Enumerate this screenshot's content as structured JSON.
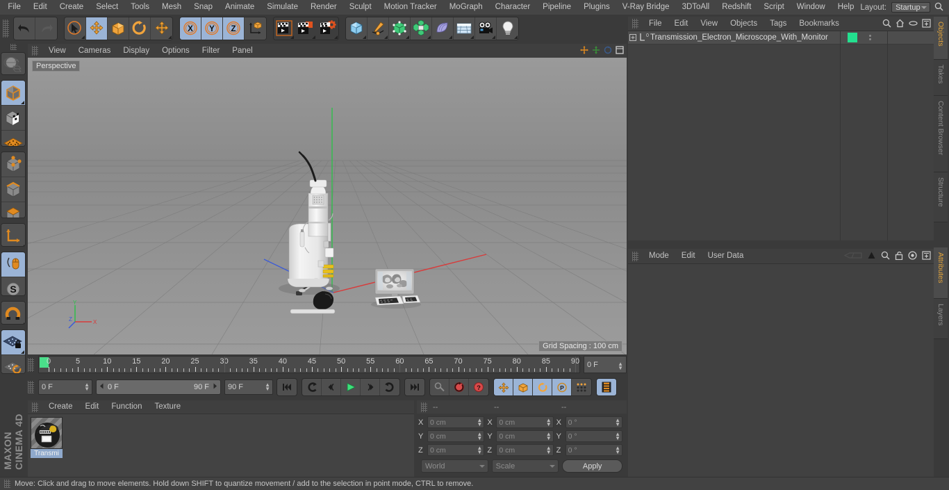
{
  "app": {
    "brand_bold": "MAXON",
    "brand_thin": "CINEMA 4D"
  },
  "menubar": {
    "items": [
      "File",
      "Edit",
      "Create",
      "Select",
      "Tools",
      "Mesh",
      "Snap",
      "Animate",
      "Simulate",
      "Render",
      "Sculpt",
      "Motion Tracker",
      "MoGraph",
      "Character",
      "Pipeline",
      "Plugins",
      "V-Ray Bridge",
      "3DToAll",
      "Redshift",
      "Script",
      "Window",
      "Help"
    ],
    "layout_label": "Layout:",
    "layout_value": "Startup",
    "search_icon": "search-icon"
  },
  "toolbar": {
    "groups": [
      {
        "name": "undo-redo",
        "buttons": [
          {
            "icon": "undo-icon",
            "label": "Undo",
            "selected": false
          },
          {
            "icon": "redo-icon",
            "label": "Redo",
            "selected": false
          }
        ]
      },
      {
        "name": "transform-tools",
        "buttons": [
          {
            "icon": "live-selection-icon",
            "label": "Live Selection",
            "selected": false
          },
          {
            "icon": "move-icon",
            "label": "Move",
            "selected": true
          },
          {
            "icon": "scale-icon",
            "label": "Scale",
            "selected": false
          },
          {
            "icon": "rotate-icon",
            "label": "Rotate",
            "selected": false
          },
          {
            "icon": "move-alt-icon",
            "label": "Move Alt",
            "selected": false
          }
        ]
      },
      {
        "name": "axis-locks",
        "buttons": [
          {
            "icon": "x-axis-icon",
            "label": "X",
            "selected": true
          },
          {
            "icon": "y-axis-icon",
            "label": "Y",
            "selected": true
          },
          {
            "icon": "z-axis-icon",
            "label": "Z",
            "selected": true
          },
          {
            "icon": "world-coordinates-icon",
            "label": "World / Object",
            "selected": false
          }
        ]
      },
      {
        "name": "render-tools",
        "buttons": [
          {
            "icon": "render-view-icon",
            "label": "Render View",
            "selected": false
          },
          {
            "icon": "render-region-icon",
            "label": "Render Region",
            "selected": false
          },
          {
            "icon": "render-settings-icon",
            "label": "Render Settings",
            "selected": false
          }
        ]
      },
      {
        "name": "create-objects",
        "buttons": [
          {
            "icon": "cube-primitive-icon",
            "label": "Add Cube Object",
            "selected": false
          },
          {
            "icon": "spline-pen-icon",
            "label": "Add Spline",
            "selected": false
          },
          {
            "icon": "nurbs-icon",
            "label": "Add Generator",
            "selected": false
          },
          {
            "icon": "array-icon",
            "label": "Add Modeling Object",
            "selected": false
          },
          {
            "icon": "deformer-icon",
            "label": "Add Deformer",
            "selected": false
          },
          {
            "icon": "environment-icon",
            "label": "Add Environment",
            "selected": false
          },
          {
            "icon": "camera-icon",
            "label": "Add Camera",
            "selected": false
          },
          {
            "icon": "light-icon",
            "label": "Add Light",
            "selected": false
          }
        ]
      }
    ]
  },
  "leftbar": {
    "groups": [
      [
        {
          "icon": "globe-tool-icon",
          "label": "Make Editable",
          "selected": false
        }
      ],
      [
        {
          "icon": "model-mode-icon",
          "label": "Model Mode",
          "selected": true
        },
        {
          "icon": "texture-mode-icon",
          "label": "Texture Mode",
          "selected": false
        },
        {
          "icon": "workplane-icon",
          "label": "Workplane",
          "selected": false
        }
      ],
      [
        {
          "icon": "points-mode-icon",
          "label": "Points",
          "selected": false
        },
        {
          "icon": "edges-mode-icon",
          "label": "Edges",
          "selected": false
        },
        {
          "icon": "polygons-mode-icon",
          "label": "Polygons",
          "selected": false
        }
      ],
      [
        {
          "icon": "axis-modify-icon",
          "label": "Enable Axis Modification",
          "selected": false
        }
      ],
      [
        {
          "icon": "viewport-solo-icon",
          "label": "Viewport Solo",
          "selected": true
        },
        {
          "icon": "snap-s-icon",
          "label": "Enable Snapping",
          "selected": true
        }
      ],
      [
        {
          "icon": "magnet-icon",
          "label": "Magnet",
          "selected": false
        }
      ],
      [
        {
          "icon": "workplane-lock-icon",
          "label": "Lock Workplane",
          "selected": true
        },
        {
          "icon": "workplane-rotate-icon",
          "label": "Planar Workplane",
          "selected": false
        }
      ]
    ]
  },
  "viewport": {
    "menu": [
      "View",
      "Cameras",
      "Display",
      "Options",
      "Filter",
      "Panel"
    ],
    "label": "Perspective",
    "grid_spacing": "Grid Spacing : 100 cm",
    "axis_labels": {
      "x": "X",
      "y": "Y",
      "z": "Z"
    },
    "corner_icons": [
      "pan-icon",
      "move-camera-icon",
      "rotate-camera-icon",
      "maximize-icon"
    ]
  },
  "timeline": {
    "ticks": [
      0,
      5,
      10,
      15,
      20,
      25,
      30,
      35,
      40,
      45,
      50,
      55,
      60,
      65,
      70,
      75,
      80,
      85,
      90
    ],
    "max_frame": 90,
    "current_frame_field": "0 F"
  },
  "playback": {
    "current_frame": "0 F",
    "range_start": "0 F",
    "range_end": "90 F",
    "end_frame": "90 F",
    "buttons": [
      {
        "icon": "go-to-start-icon",
        "label": "Go to Start",
        "selected": false
      },
      {
        "icon": "previous-keyframe-icon",
        "label": "Go to Previous Key",
        "selected": false
      },
      {
        "icon": "previous-frame-icon",
        "label": "Go to Previous Frame",
        "selected": false
      },
      {
        "icon": "play-icon",
        "label": "Play",
        "selected": false
      },
      {
        "icon": "next-frame-icon",
        "label": "Go to Next Frame",
        "selected": false
      },
      {
        "icon": "next-keyframe-icon",
        "label": "Go to Next Key",
        "selected": false
      },
      {
        "icon": "go-to-end-icon",
        "label": "Go to End",
        "selected": false
      }
    ],
    "record_buttons": [
      {
        "icon": "autokey-key-icon",
        "label": "Record Active Objects",
        "selected": false
      },
      {
        "icon": "autokeying-icon",
        "label": "Autokeying",
        "selected": false
      },
      {
        "icon": "keyframe-selection-icon",
        "label": "Keyframe Selection",
        "selected": false
      }
    ],
    "param_buttons": [
      {
        "icon": "position-key-icon",
        "label": "Position",
        "selected": true
      },
      {
        "icon": "scale-key-icon",
        "label": "Scale",
        "selected": true
      },
      {
        "icon": "rotation-key-icon",
        "label": "Rotation",
        "selected": true
      },
      {
        "icon": "param-key-icon",
        "label": "Parameter",
        "selected": true
      },
      {
        "icon": "pla-key-icon",
        "label": "Point Level Animation",
        "selected": false
      }
    ],
    "timeline_toggle": {
      "icon": "timeline-filmstrip-icon",
      "label": "Animate Mode",
      "selected": true
    }
  },
  "materials": {
    "menu": [
      "Create",
      "Edit",
      "Function",
      "Texture"
    ],
    "items": [
      {
        "name": "Transmi",
        "selected": true
      }
    ]
  },
  "coordinates": {
    "headers": [
      "--",
      "--",
      "--"
    ],
    "rows": [
      {
        "label": "X",
        "position": "0 cm",
        "size": "0 cm",
        "rotation": "0 °"
      },
      {
        "label": "Y",
        "position": "0 cm",
        "size": "0 cm",
        "rotation": "0 °"
      },
      {
        "label": "Z",
        "position": "0 cm",
        "size": "0 cm",
        "rotation": "0 °"
      }
    ],
    "system": "World",
    "mode": "Scale",
    "apply_label": "Apply"
  },
  "objects": {
    "menu": [
      "File",
      "Edit",
      "View",
      "Objects",
      "Tags",
      "Bookmarks"
    ],
    "icons": [
      "search-icon",
      "home-icon",
      "ellipse-icon",
      "add-layer-icon"
    ],
    "rows": [
      {
        "name": "Transmission_Electron_Microscope_With_Monitor",
        "color": "#23e08f",
        "expandable": true,
        "tag": "0"
      }
    ]
  },
  "attributes": {
    "menu": [
      "Mode",
      "Edit",
      "User Data"
    ],
    "icons": [
      "history-back-icon",
      "arrow-up-icon",
      "search-icon",
      "lock-icon",
      "target-icon",
      "add-icon"
    ]
  },
  "vtabs_top": [
    {
      "label": "Objects",
      "active": true
    },
    {
      "label": "Takes",
      "active": false
    },
    {
      "label": "Content Browser",
      "active": false
    },
    {
      "label": "Structure",
      "active": false
    }
  ],
  "vtabs_bottom": [
    {
      "label": "Attributes",
      "active": true
    },
    {
      "label": "Layers",
      "active": false
    }
  ],
  "statusbar": {
    "text": "Move: Click and drag to move elements. Hold down SHIFT to quantize movement / add to the selection in point mode, CTRL to remove."
  },
  "colors": {
    "accent_orange": "#e08a20",
    "selection_blue": "#9bb4d6",
    "object_green": "#23e08f",
    "play_green": "#3de07a",
    "record_red": "#e04a4a",
    "panel_bg": "#3a3a3a"
  }
}
